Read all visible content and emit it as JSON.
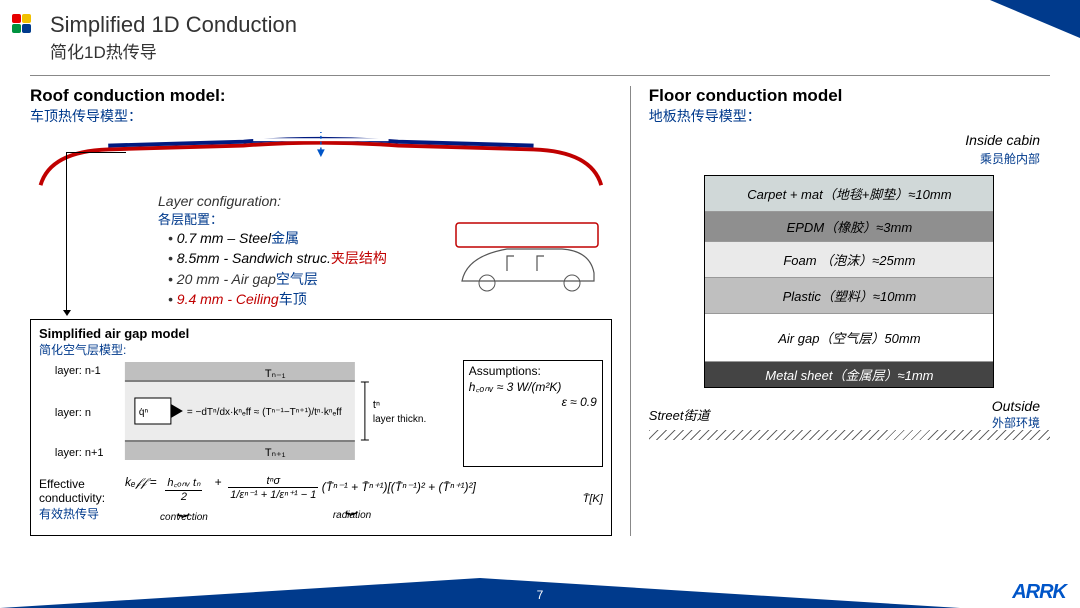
{
  "header": {
    "title_en": "Simplified 1D Conduction",
    "title_zh": "简化1D热传导"
  },
  "roof": {
    "section_title": "Roof conduction model:",
    "section_title_zh": "车顶热传导模型：",
    "layer_config_title": "Layer configuration:",
    "layer_config_title_zh": "各层配置：",
    "layers": [
      {
        "txt": "0.7 mm – Steel",
        "zh": "金属"
      },
      {
        "txt": "8.5mm - Sandwich struc.",
        "zh": "夹层结构"
      },
      {
        "txt": "20 mm - Air gap",
        "zh": "空气层"
      },
      {
        "txt": "9.4 mm - Ceiling",
        "zh": "车顶"
      }
    ]
  },
  "airgap": {
    "title": "Simplified air gap model",
    "title_zh": "简化空气层模型:",
    "labels": {
      "layer_nm1": "layer: n-1",
      "layer_n": "layer: n",
      "layer_np1": "layer: n+1",
      "Tnm1": "Tₙ₋₁",
      "Tnp1": "Tₙ₊₁",
      "tn": "tⁿ",
      "thick": "layer thickn."
    },
    "qexpr_left": "q̇ⁿ꜀ₒₙ𝒹",
    "qexpr_mid": "= − dTⁿ/dx · kⁿₑ𝒻𝒻 ≈ (Tⁿ⁻¹ − Tⁿ⁺¹)/tⁿ · kⁿₑ𝒻𝒻",
    "assump_title": "Assumptions:",
    "assump_h": "h꜀ₒₙᵥ ≈ 3 W/(m²K)",
    "assump_eps": "ε ≈ 0.9",
    "eff_label_en": "Effective conductivity:",
    "eff_label_zh": "有效热传导",
    "keff": "kₑ𝒻𝒻 =",
    "conv_n": "h꜀ₒₙᵥ tₙ",
    "conv_d": "2",
    "conv_lbl": "convection",
    "rad_n": "tⁿσ",
    "rad_d": "1/εⁿ⁻¹ + 1/εⁿ⁺¹ − 1",
    "rad_tail": "(T̄ⁿ⁻¹ + T̄ⁿ⁺¹)[(T̄ⁿ⁻¹)² + (T̄ⁿ⁺¹)²]",
    "rad_lbl": "radiation",
    "Tbar": "T̄[K]"
  },
  "floor": {
    "section_title": "Floor conduction model",
    "section_title_zh": "地板热传导模型：",
    "inside_en": "Inside cabin",
    "inside_zh": "乘员舱内部",
    "layers": [
      {
        "cls": "carpet",
        "txt": "Carpet + mat（地毯+脚垫）≈10mm"
      },
      {
        "cls": "epdm",
        "txt": "EPDM（橡胶）≈3mm"
      },
      {
        "cls": "foam",
        "txt": "Foam （泡沫）≈25mm"
      },
      {
        "cls": "plastic",
        "txt": "Plastic（塑料）≈10mm"
      },
      {
        "cls": "airgap",
        "txt": "Air gap（空气层）50mm"
      },
      {
        "cls": "metal",
        "txt": "Metal sheet（金属层）≈1mm"
      }
    ],
    "outside_en": "Outside",
    "outside_zh": "外部环境",
    "street": "Street街道"
  },
  "footer": {
    "page": "7",
    "brand": "ARRK"
  }
}
